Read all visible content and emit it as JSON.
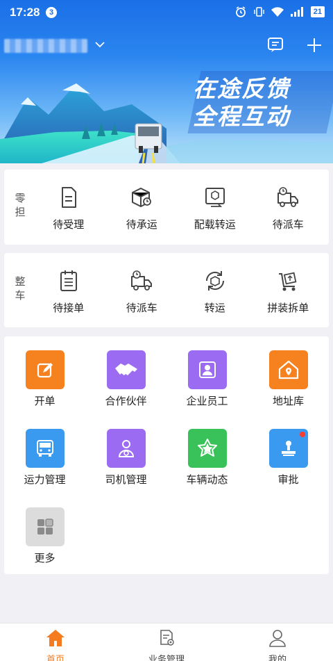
{
  "status_bar": {
    "time": "17:28",
    "notification_count": "3",
    "battery": "21"
  },
  "header": {
    "slogan_line1": "在途反馈",
    "slogan_line2": "全程互动"
  },
  "ltl_section": {
    "title": "零担",
    "items": [
      {
        "label": "待受理",
        "icon": "document-icon"
      },
      {
        "label": "待承运",
        "icon": "package-clock-icon"
      },
      {
        "label": "配载转运",
        "icon": "box-transfer-icon"
      },
      {
        "label": "待派车",
        "icon": "truck-clock-icon"
      }
    ]
  },
  "ftl_section": {
    "title": "整车",
    "items": [
      {
        "label": "待接单",
        "icon": "clipboard-icon"
      },
      {
        "label": "待派车",
        "icon": "truck-clock-icon"
      },
      {
        "label": "转运",
        "icon": "box-cycle-icon"
      },
      {
        "label": "拼装拆单",
        "icon": "cart-box-icon"
      }
    ]
  },
  "apps": [
    {
      "label": "开单",
      "icon": "edit-icon",
      "color": "#f5811f"
    },
    {
      "label": "合作伙伴",
      "icon": "handshake-icon",
      "color": "#9b6cf2"
    },
    {
      "label": "企业员工",
      "icon": "employee-icon",
      "color": "#9b6cf2"
    },
    {
      "label": "地址库",
      "icon": "home-location-icon",
      "color": "#f5811f"
    },
    {
      "label": "运力管理",
      "icon": "truck-front-icon",
      "color": "#3a9af0"
    },
    {
      "label": "司机管理",
      "icon": "driver-icon",
      "color": "#9b6cf2"
    },
    {
      "label": "车辆动态",
      "icon": "star-badge-icon",
      "color": "#3ac25a"
    },
    {
      "label": "审批",
      "icon": "stamp-icon",
      "color": "#3a9af0"
    },
    {
      "label": "更多",
      "icon": "more-grid-icon",
      "color": "#dcdcdc"
    }
  ],
  "tabbar": [
    {
      "label": "首页",
      "active": true
    },
    {
      "label": "业务管理",
      "active": false
    },
    {
      "label": "我的",
      "active": false
    }
  ],
  "colors": {
    "accent": "#f47b20",
    "primary_blue": "#1a6fe6",
    "purple": "#9b6cf2",
    "green": "#3ac25a"
  }
}
